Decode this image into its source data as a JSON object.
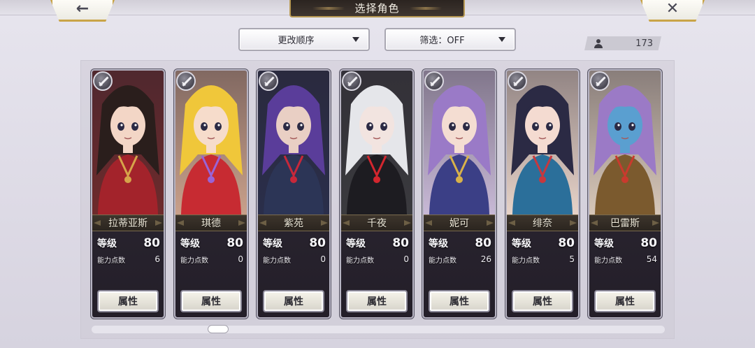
{
  "header": {
    "title": "选择角色",
    "back_icon": "←",
    "close_icon": "✕"
  },
  "controls": {
    "sort": {
      "label": "更改顺序"
    },
    "filter": {
      "label": "筛选：OFF"
    },
    "character_count": "173"
  },
  "characters": [
    {
      "name": "拉蒂亚斯",
      "level_label": "等级",
      "level": "80",
      "ap_label": "能力点数",
      "ap": "6",
      "button": "属性",
      "palette": {
        "bg": "#6e2a2c",
        "hair": "#2a1e1c",
        "skin": "#f3d6c6",
        "outfit": "#a3232b",
        "accent": "#d6a44a"
      }
    },
    {
      "name": "琪德",
      "level_label": "等级",
      "level": "80",
      "ap_label": "能力点数",
      "ap": "0",
      "button": "属性",
      "palette": {
        "bg": "#c9a08a",
        "hair": "#f0c73a",
        "skin": "#f6dccb",
        "outfit": "#c72b32",
        "accent": "#9a63d6"
      }
    },
    {
      "name": "紫苑",
      "level_label": "等级",
      "level": "80",
      "ap_label": "能力点数",
      "ap": "0",
      "button": "属性",
      "palette": {
        "bg": "#2a2e4a",
        "hair": "#5a3d9a",
        "skin": "#e9cfc4",
        "outfit": "#2c3556",
        "accent": "#c7283a"
      }
    },
    {
      "name": "千夜",
      "level_label": "等级",
      "level": "80",
      "ap_label": "能力点数",
      "ap": "0",
      "button": "属性",
      "palette": {
        "bg": "#3a3a3e",
        "hair": "#e5e6ea",
        "skin": "#f2e4e0",
        "outfit": "#1d1c21",
        "accent": "#d3262e"
      }
    },
    {
      "name": "妮可",
      "level_label": "等级",
      "level": "80",
      "ap_label": "能力点数",
      "ap": "26",
      "button": "属性",
      "palette": {
        "bg": "#c8b9d6",
        "hair": "#9a7ac7",
        "skin": "#f4ddd2",
        "outfit": "#3b3f86",
        "accent": "#d8b24a"
      }
    },
    {
      "name": "绯奈",
      "level_label": "等级",
      "level": "80",
      "ap_label": "能力点数",
      "ap": "5",
      "button": "属性",
      "palette": {
        "bg": "#e7d3c8",
        "hair": "#2b2a44",
        "skin": "#f4dbd1",
        "outfit": "#2b6f9a",
        "accent": "#c7383e"
      }
    },
    {
      "name": "巴雷斯",
      "level_label": "等级",
      "level": "80",
      "ap_label": "能力点数",
      "ap": "54",
      "button": "属性",
      "palette": {
        "bg": "#d7c7b8",
        "hair": "#9b7ac6",
        "skin": "#5a9fd0",
        "outfit": "#7b5a2e",
        "accent": "#c93a2e"
      }
    }
  ],
  "icons": {
    "weapon": "sword-icon",
    "user": "user-icon"
  }
}
